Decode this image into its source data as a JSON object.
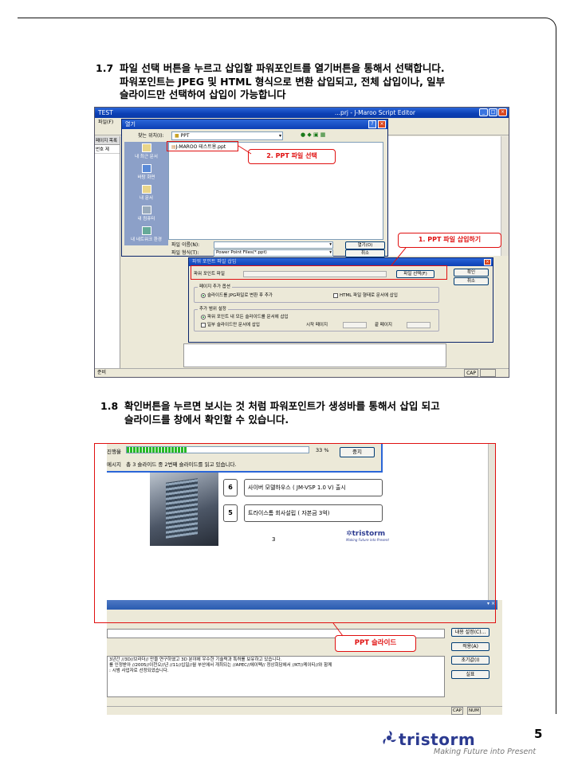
{
  "step17": {
    "number": "1.7",
    "line1": "파일 선택 버튼을 누르고 삽입할 파워포인트를 열기버튼을 통해서 선택합니다.",
    "line2": "파워포인트는 JPEG 및 HTML 형식으로 변환 삽입되고, 전체 삽입이나, 일부",
    "line3": "슬라이드만 선택하여 삽입이 가능합니다"
  },
  "screen1": {
    "window_title": "TEST",
    "editor_title": "...prj - J-Maroo Script Editor",
    "menu_file": "파일(F)",
    "left_header": "페이지 목록",
    "left_col_no": "번호",
    "left_col_2": "제",
    "open_dialog": {
      "title": "열기",
      "look_in_label": "찾는 위치(I):",
      "look_in_value": "PPT",
      "places": [
        "내 최근 문서",
        "바탕 화면",
        "내 문서",
        "내 컴퓨터",
        "내 네트워크 환경"
      ],
      "file_item": "J-MAROO 테스트용.ppt",
      "filename_label": "파일 이름(N):",
      "filetype_label": "파일 형식(T):",
      "filetype_value": "Power Point Files(*.ppt)",
      "open_button": "열기(O)",
      "cancel_button": "취소"
    },
    "insert_dialog": {
      "title": "파워 포인트 파일 삽입",
      "ppt_file_label": "파워 포인트 파일",
      "file_select_button": "파일 선택(F)",
      "ok_button": "확인",
      "cancel_button": "취소",
      "page_add_option_label": "페이지 추가 옵션",
      "option_jpg": "슬라이드를 JPG파일로 변환 후 추가",
      "option_html": "HTML 파일 형태로 문서에 삽입",
      "range_label": "추가 범위 설정",
      "range_all": "파워 포인트 내 모든 슬라이드를 문서에 삽입",
      "range_partial": "일부 슬라이드만 문서에 삽입",
      "start_page_label": "시작 페이지",
      "end_page_label": "끝 페이지"
    },
    "status_left": "준비",
    "status_cap": "CAP",
    "callout_select": "2. PPT 파일 선택",
    "callout_insert": "1. PPT 파일 삽입하기"
  },
  "step18": {
    "number": "1.8",
    "line1": "확인버튼을 누르면 보시는 것 처럼 파워포인트가 생성바를 통해서 삽입 되고",
    "line2": "슬라이드를 창에서 확인할 수 있습니다."
  },
  "progress": 0.33,
  "screen2": {
    "progress_label": "진행율",
    "progress_percent": "33 %",
    "stop_button": "중지",
    "message_label": "메시지",
    "message": "총 3 슬라이드 중 2번째 슬라이드를 읽고 있습니다.",
    "slide_items": [
      {
        "num": "6",
        "text": "사이버 모델하우스 ( JM-VSP 1.0 V) 출시"
      },
      {
        "num": "5",
        "text": "트라이스톰 회사설립 ( 자본금 3억)"
      }
    ],
    "slide_page_number": "3",
    "slide_logo": "tristorm",
    "slide_logo_tag": "Making Future into Present",
    "text_lines": [
      "3년간 //3D//브라더// 만을 연구하였고 3D 분야에 우수한 기술력과 특허를 보유하고 있습니다.",
      "를 인정받아 //2005//이천오//년 //11//십일//월 부산에서 개최되는 //APEC//에이펙// 정상회담에서 //KT//케이티//와 함께",
      ": 시범 사업자로 선정되었습니다."
    ],
    "buttons": [
      "내용 설정(C)...",
      "적용(A)",
      "초기값(I)",
      "실표"
    ],
    "status_cap": "CAP",
    "status_num": "NUM",
    "callout": "PPT 슬라이드"
  },
  "footer": {
    "logo_text": "tristorm",
    "tagline": "Making Future into Present",
    "page_number": "5"
  }
}
